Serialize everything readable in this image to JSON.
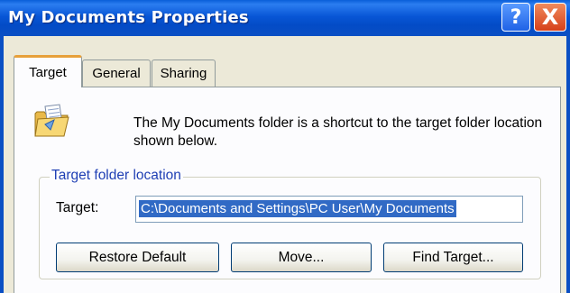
{
  "window": {
    "title": "My Documents Properties",
    "help_label": "?",
    "close_label": "X"
  },
  "tabs": [
    {
      "label": "Target",
      "active": true
    },
    {
      "label": "General",
      "active": false
    },
    {
      "label": "Sharing",
      "active": false
    }
  ],
  "description": "The My Documents folder is a shortcut to the target folder location shown below.",
  "group": {
    "legend": "Target folder location",
    "target_label": "Target:",
    "target_value": "C:\\Documents and Settings\\PC User\\My Documents"
  },
  "buttons": {
    "restore_default": "Restore Default",
    "move": "Move...",
    "find_target": "Find Target..."
  },
  "icons": {
    "folder": "folder-document-icon"
  },
  "colors": {
    "titlebar": "#0a5fd8",
    "tab_highlight": "#e7a03a",
    "legend_text": "#1f3fb4",
    "selection": "#316ac5"
  }
}
